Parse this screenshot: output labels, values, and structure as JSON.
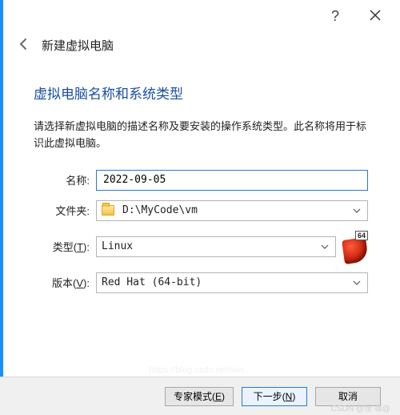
{
  "titlebar": {
    "help_glyph": "?",
    "close_label": "Close"
  },
  "header": {
    "back_label": "Back",
    "title": "新建虚拟电脑"
  },
  "section": {
    "title": "虚拟电脑名称和系统类型",
    "description": "请选择新虚拟电脑的描述名称及要安装的操作系统类型。此名称将用于标识此虚拟电脑。"
  },
  "form": {
    "name": {
      "label": "名称:",
      "value": "2022-09-05"
    },
    "folder": {
      "label": "文件夹:",
      "value": "D:\\MyCode\\vm"
    },
    "type": {
      "label_pre": "类型(",
      "hotkey": "T",
      "label_post": "):",
      "value": "Linux"
    },
    "version": {
      "label_pre": "版本(",
      "hotkey": "V",
      "label_post": "):",
      "value": "Red Hat (64-bit)"
    },
    "arch_badge": "64"
  },
  "buttons": {
    "expert_pre": "专家模式(",
    "expert_hot": "E",
    "expert_post": ")",
    "next_pre": "下一步(",
    "next_hot": "N",
    "next_post": ")",
    "cancel": "取消"
  },
  "watermark": "CSDN @怪 咖@"
}
